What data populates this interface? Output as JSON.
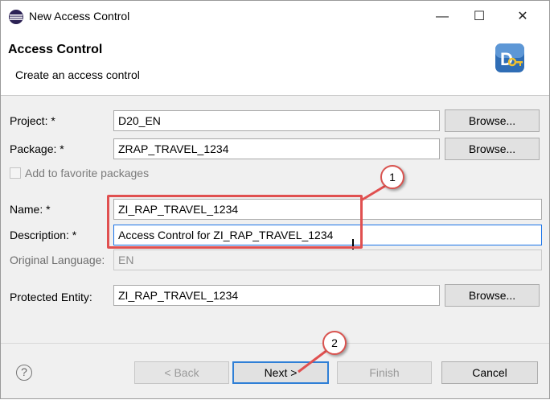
{
  "window": {
    "title": "New Access Control",
    "minimize_glyph": "—",
    "maximize_glyph": "☐",
    "close_glyph": "✕"
  },
  "header": {
    "title": "Access Control",
    "description": "Create an access control",
    "icon": "access-control-key-icon"
  },
  "form": {
    "project_label": "Project: *",
    "project_value": "D20_EN",
    "package_label": "Package: *",
    "package_value": "ZRAP_TRAVEL_1234",
    "favorite_label": "Add to favorite packages",
    "favorite_checked": false,
    "name_label": "Name: *",
    "name_value": "ZI_RAP_TRAVEL_1234",
    "description_label": "Description: *",
    "description_value": "Access Control for ZI_RAP_TRAVEL_1234",
    "language_label": "Original Language:",
    "language_value": "EN",
    "entity_label": "Protected Entity:",
    "entity_value": "ZI_RAP_TRAVEL_1234",
    "browse_label": "Browse..."
  },
  "footer": {
    "help_glyph": "?",
    "back_label": "< Back",
    "next_label": "Next >",
    "finish_label": "Finish",
    "cancel_label": "Cancel"
  },
  "annotations": {
    "callout_1": "1",
    "callout_2": "2",
    "color": "#e05050"
  }
}
